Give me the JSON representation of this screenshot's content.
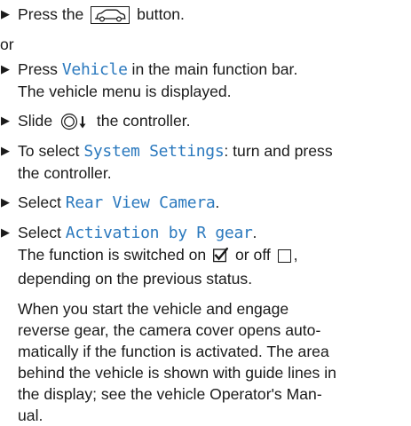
{
  "bullet_glyph": "▶",
  "steps": {
    "s1": {
      "before": "Press the",
      "after": "button.",
      "icon": "car-button-icon"
    },
    "or": "or",
    "s2": {
      "before": "Press",
      "ui": "Vehicle",
      "after": "in the main function bar.",
      "line2": "The vehicle menu is displayed."
    },
    "s3": {
      "before": "Slide",
      "after": "the controller.",
      "icon": "controller-slide-down-icon"
    },
    "s4": {
      "before": "To select",
      "ui": "System Settings",
      "after": ": turn and press",
      "line2": "the controller."
    },
    "s5": {
      "before": "Select",
      "ui": "Rear View Camera",
      "after": "."
    },
    "s6": {
      "before": "Select",
      "ui": "Activation by R gear",
      "after": ".",
      "line2_a": "The function is switched on",
      "line2_b": "or off",
      "line2_c": ",",
      "line3": "depending on the previous status."
    }
  },
  "description": {
    "line1": "When you start the vehicle and engage",
    "line2": "reverse gear, the camera cover opens auto-",
    "line3": "matically if the function is activated. The area",
    "line4": "behind the vehicle is shown with guide lines in",
    "line5": "the display; see the vehicle Operator's Man-",
    "line6": "ual."
  },
  "colors": {
    "text": "#1a1a1a",
    "ui_highlight": "#2b79be"
  }
}
